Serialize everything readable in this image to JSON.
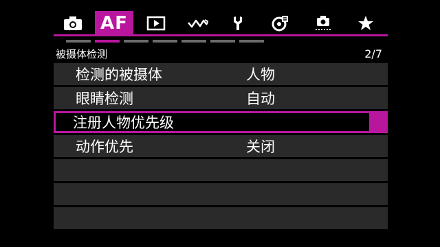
{
  "tabs": [
    {
      "name": "camera-icon"
    },
    {
      "name": "af",
      "label": "AF",
      "active": true
    },
    {
      "name": "playback-icon"
    },
    {
      "name": "wireless-icon"
    },
    {
      "name": "setup-wrench-icon"
    },
    {
      "name": "custom-settings-icon"
    },
    {
      "name": "camera-settings-icon"
    },
    {
      "name": "star-icon"
    }
  ],
  "accent_color": "#b9169e",
  "page_indicator": {
    "total": 7,
    "current": 2
  },
  "header": {
    "title": "被摄体检测",
    "page": "2/7"
  },
  "menu": {
    "items": [
      {
        "label": "检测的被摄体",
        "value": "人物"
      },
      {
        "label": "眼睛检测",
        "value": "自动"
      },
      {
        "label": "注册人物优先级",
        "value": "",
        "selected": true
      },
      {
        "label": "动作优先",
        "value": "关闭"
      },
      {
        "label": "",
        "value": ""
      },
      {
        "label": "",
        "value": ""
      },
      {
        "label": "",
        "value": ""
      }
    ]
  }
}
